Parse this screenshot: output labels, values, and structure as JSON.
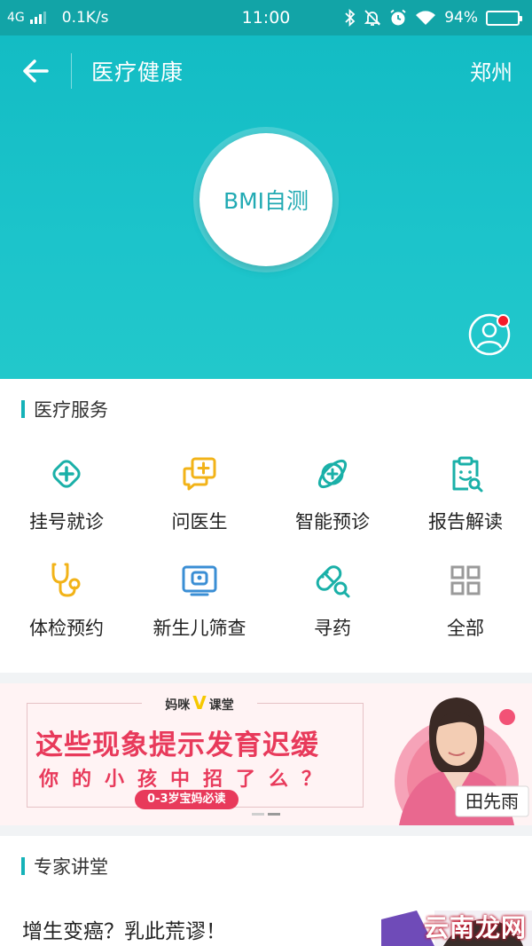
{
  "status_bar": {
    "network": "4G",
    "speed": "0.1K/s",
    "time": "11:00",
    "battery": "94%",
    "battery_level": 0.94,
    "icons": [
      "bluetooth-icon",
      "mute-bell-icon",
      "alarm-icon",
      "wifi-icon",
      "battery-icon"
    ]
  },
  "header": {
    "title": "医疗健康",
    "city": "郑州",
    "bmi_button": "BMI自测",
    "profile_badge": true
  },
  "medical_services": {
    "title": "医疗服务",
    "items": [
      {
        "label": "挂号就诊",
        "icon": "medical-cross-icon",
        "color": "#1ab0a8"
      },
      {
        "label": "问医生",
        "icon": "chat-bubble-plus-icon",
        "color": "#f2b318"
      },
      {
        "label": "智能预诊",
        "icon": "orbit-plus-icon",
        "color": "#1ab0a8"
      },
      {
        "label": "报告解读",
        "icon": "clipboard-search-icon",
        "color": "#1ab0a8"
      },
      {
        "label": "体检预约",
        "icon": "stethoscope-icon",
        "color": "#f2b318"
      },
      {
        "label": "新生儿筛查",
        "icon": "monitor-baby-icon",
        "color": "#3a8ed4"
      },
      {
        "label": "寻药",
        "icon": "pill-search-icon",
        "color": "#1ab0a8"
      },
      {
        "label": "全部",
        "icon": "grid-icon",
        "color": "#9a9a9a"
      }
    ]
  },
  "banner": {
    "brand_left": "妈咪",
    "brand_mark": "V",
    "brand_right": "课堂",
    "headline": "这些现象提示发育迟缓",
    "subline": "你的小孩中招了么？",
    "pill": "0-3岁宝妈必读",
    "signature": "田先雨",
    "page_count": 2,
    "active_page": 2
  },
  "expert_lectures": {
    "title": "专家讲堂",
    "articles": [
      {
        "title": "增生变癌？乳此荒谬！"
      }
    ]
  },
  "watermark": "云南龙网",
  "colors": {
    "primary": "#1cc4cb",
    "status_bar": "#12a4a7",
    "accent_red": "#e83a5b",
    "accent_yellow": "#f2b318"
  }
}
